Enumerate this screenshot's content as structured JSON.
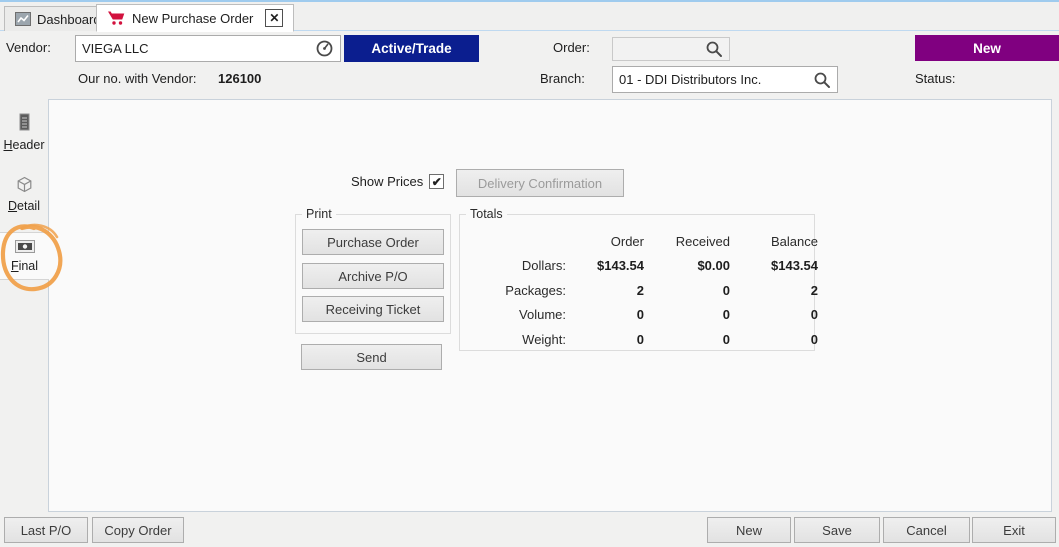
{
  "tabs": {
    "dashboard": "Dashboard",
    "active": "New Purchase Order"
  },
  "header": {
    "vendor_label": "Vendor:",
    "vendor_value": "VIEGA LLC",
    "active_trade_button": "Active/Trade",
    "order_label": "Order:",
    "order_value": "",
    "new_button": "New",
    "our_no_label": "Our no. with Vendor:",
    "our_no_value": "126100",
    "branch_label": "Branch:",
    "branch_value": "01 - DDI Distributors Inc.",
    "status_label": "Status:"
  },
  "sidebar": {
    "items": [
      {
        "key": "H",
        "rest": "eader"
      },
      {
        "key": "D",
        "rest": "etail"
      },
      {
        "key": "F",
        "rest": "inal"
      }
    ]
  },
  "main": {
    "show_prices_label": "Show Prices",
    "show_prices_checked": true,
    "checkmark": "✔",
    "delivery_confirmation_button": "Delivery Confirmation",
    "print_group": {
      "title": "Print",
      "buttons": [
        "Purchase Order",
        "Archive P/O",
        "Receiving Ticket"
      ]
    },
    "send_button": "Send",
    "totals": {
      "title": "Totals",
      "columns": [
        "Order",
        "Received",
        "Balance"
      ],
      "rows": [
        {
          "label": "Dollars:",
          "values": [
            "$143.54",
            "$0.00",
            "$143.54"
          ]
        },
        {
          "label": "Packages:",
          "values": [
            "2",
            "0",
            "2"
          ]
        },
        {
          "label": "Volume:",
          "values": [
            "0",
            "0",
            "0"
          ]
        },
        {
          "label": "Weight:",
          "values": [
            "0",
            "0",
            "0"
          ]
        }
      ]
    }
  },
  "footer": {
    "last_po": "Last P/O",
    "copy_order": "Copy Order",
    "new": "New",
    "save": "Save",
    "cancel": "Cancel",
    "exit": "Exit"
  },
  "icons": {
    "close": "✕"
  },
  "colors": {
    "active_trade_bg": "#0B1E8F",
    "new_button_bg": "#800080",
    "cart_icon": "#D2123E",
    "highlight_circle": "#F0A14C"
  }
}
